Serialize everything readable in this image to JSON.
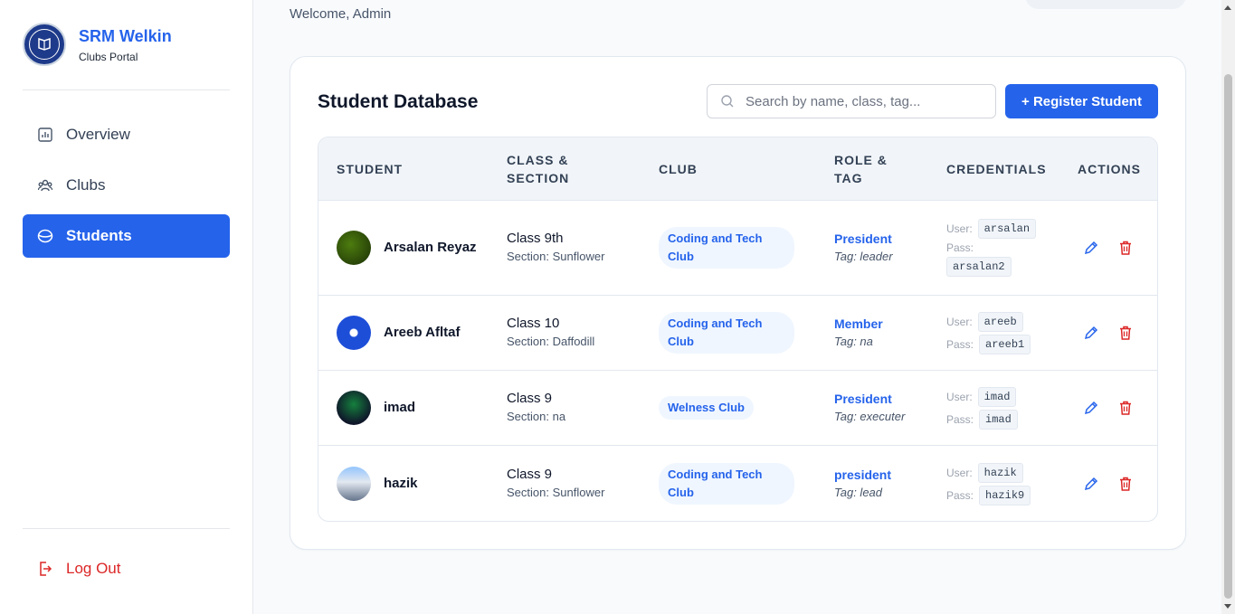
{
  "app": {
    "brand_title": "SRM Welkin",
    "brand_subtitle": "Clubs Portal",
    "logo_icon": "school-crest-logo"
  },
  "sidebar": {
    "items": [
      {
        "label": "Overview",
        "icon": "chart-icon",
        "active": false
      },
      {
        "label": "Clubs",
        "icon": "users-icon",
        "active": false
      },
      {
        "label": "Students",
        "icon": "student-cap-icon",
        "active": true
      }
    ],
    "logout_label": "Log Out"
  },
  "header": {
    "welcome": "Welcome, Admin"
  },
  "database": {
    "title": "Student Database",
    "search_placeholder": "Search by name, class, tag...",
    "register_label": "+ Register Student",
    "columns": [
      "STUDENT",
      "CLASS & SECTION",
      "CLUB",
      "ROLE & TAG",
      "CREDENTIALS",
      "ACTIONS"
    ],
    "rows": [
      {
        "name": "Arsalan Reyaz",
        "class": "Class 9th",
        "section": "Section: Sunflower",
        "club": "Coding and Tech Club",
        "role": "President",
        "tag": "Tag: leader",
        "user_label": "User:",
        "user": "arsalan",
        "pass_label": "Pass:",
        "pass": "arsalan2"
      },
      {
        "name": "Areeb Afltaf",
        "class": "Class 10",
        "section": "Section: Daffodill",
        "club": "Coding and Tech Club",
        "role": "Member",
        "tag": "Tag: na",
        "user_label": "User:",
        "user": "areeb",
        "pass_label": "Pass:",
        "pass": "areeb1"
      },
      {
        "name": "imad",
        "class": "Class 9",
        "section": "Section: na",
        "club": "Welness Club",
        "role": "President",
        "tag": "Tag: executer",
        "user_label": "User:",
        "user": "imad",
        "pass_label": "Pass:",
        "pass": "imad"
      },
      {
        "name": "hazik",
        "class": "Class 9",
        "section": "Section: Sunflower",
        "club": "Coding and Tech Club",
        "role": "president",
        "tag": "Tag: lead",
        "user_label": "User:",
        "user": "hazik",
        "pass_label": "Pass:",
        "pass": "hazik9"
      }
    ]
  },
  "colors": {
    "accent": "#2563eb",
    "danger": "#dc2626",
    "pill_bg": "#eff6ff"
  }
}
